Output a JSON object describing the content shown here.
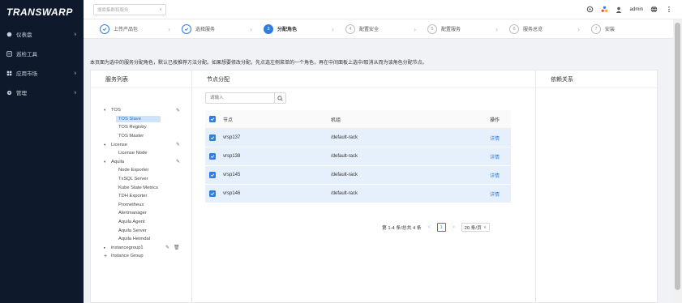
{
  "brand": {
    "logo_text": "TRANSWARP"
  },
  "sidebar": {
    "items": [
      {
        "label": "仪表盘",
        "icon": "dashboard-icon",
        "has_chevron": true
      },
      {
        "label": "巡检工具",
        "icon": "inspection-icon",
        "has_chevron": false
      },
      {
        "label": "应用市场",
        "icon": "market-icon",
        "has_chevron": true
      },
      {
        "label": "管理",
        "icon": "gear-icon",
        "has_chevron": true
      }
    ]
  },
  "topbar": {
    "cluster_placeholder": "搜索集群和服务",
    "user": "admin"
  },
  "steps": [
    {
      "num": "1",
      "label": "上传产品包",
      "state": "done"
    },
    {
      "num": "2",
      "label": "选择服务",
      "state": "done"
    },
    {
      "num": "3",
      "label": "分配角色",
      "state": "active"
    },
    {
      "num": "4",
      "label": "配置安全",
      "state": "todo"
    },
    {
      "num": "5",
      "label": "配置服务",
      "state": "todo"
    },
    {
      "num": "6",
      "label": "服务总览",
      "state": "todo"
    },
    {
      "num": "7",
      "label": "安装",
      "state": "todo"
    }
  ],
  "description": "本页面为选中的服务分配角色，默认已按推荐方法分配。如果想要修改分配，先点选左侧菜单的一个角色，再在中间面板上选中/取消从而为该角色分配节点。",
  "panel": {
    "services_title": "服务列表",
    "nodes_title": "节点分配",
    "deps_title": "依赖关系"
  },
  "tree": [
    {
      "level": 0,
      "label": "TOS",
      "caret": "▾",
      "edit": true
    },
    {
      "level": 1,
      "label": "TOS Slave",
      "selected": true
    },
    {
      "level": 1,
      "label": "TOS Registry"
    },
    {
      "level": 1,
      "label": "TOS Master"
    },
    {
      "level": 0,
      "label": "License",
      "caret": "▾",
      "edit": true
    },
    {
      "level": 1,
      "label": "License Node"
    },
    {
      "level": 0,
      "label": "Aquila",
      "caret": "▾",
      "edit": true
    },
    {
      "level": 1,
      "label": "Node Exporter"
    },
    {
      "level": 1,
      "label": "TxSQL Server"
    },
    {
      "level": 1,
      "label": "Kube State Metrics"
    },
    {
      "level": 1,
      "label": "TDH Exporter"
    },
    {
      "level": 1,
      "label": "Prometheus"
    },
    {
      "level": 1,
      "label": "Alertmanager"
    },
    {
      "level": 1,
      "label": "Aquila Agent"
    },
    {
      "level": 1,
      "label": "Aquila Server"
    },
    {
      "level": 1,
      "label": "Aquila Heimdal"
    },
    {
      "level": 0,
      "label": "instancegroup1",
      "caret": "▸",
      "edit": true,
      "delete": true
    },
    {
      "level": 0,
      "label": "Instance Group",
      "caret": "+"
    }
  ],
  "search": {
    "placeholder": "请输入"
  },
  "table": {
    "headers": {
      "node": "节点",
      "rack": "机组",
      "action": "操作"
    },
    "rows": [
      {
        "node": "vrsp137",
        "rack": "/default-rack",
        "action": "详情"
      },
      {
        "node": "vrsp138",
        "rack": "/default-rack",
        "action": "详情"
      },
      {
        "node": "vrsp145",
        "rack": "/default-rack",
        "action": "详情"
      },
      {
        "node": "vrsp146",
        "rack": "/default-rack",
        "action": "详情"
      }
    ]
  },
  "pagination": {
    "summary": "第 1-4 条/总共 4 条",
    "current_page": "1",
    "page_size": "20 条/页"
  },
  "colors": {
    "accent": "#2f7de1",
    "sidebar_bg": "#0e1a2b",
    "row_selected": "#e6f0fc"
  }
}
